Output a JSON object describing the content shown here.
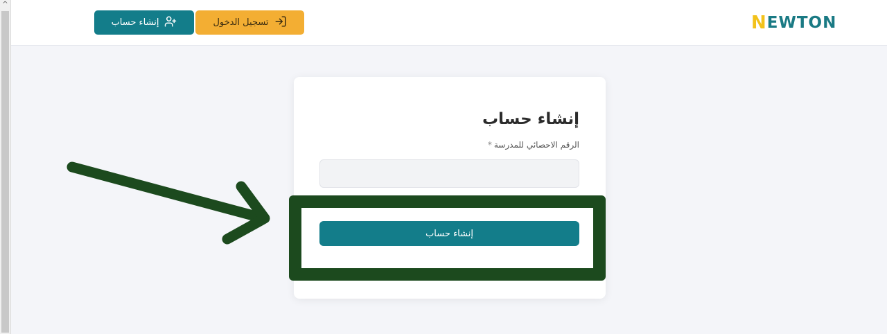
{
  "header": {
    "logo_first": "N",
    "logo_rest": "EWTON",
    "login_label": "تسجيل الدخول",
    "signup_label": "إنشاء حساب"
  },
  "card": {
    "title": "إنشاء حساب",
    "field_label": "الرقم الاحصائي للمدرسة",
    "field_required": "*",
    "field_value": "",
    "submit_label": "إنشاء حساب"
  },
  "colors": {
    "accent_teal": "#137d8a",
    "login_orange": "#f3ae33",
    "annotation_green": "#1c4a1e",
    "logo_yellow": "#f2c21b"
  },
  "icons": {
    "login": "login-arrow-icon",
    "signup": "user-plus-icon",
    "annotation": "arrow-annotation"
  }
}
